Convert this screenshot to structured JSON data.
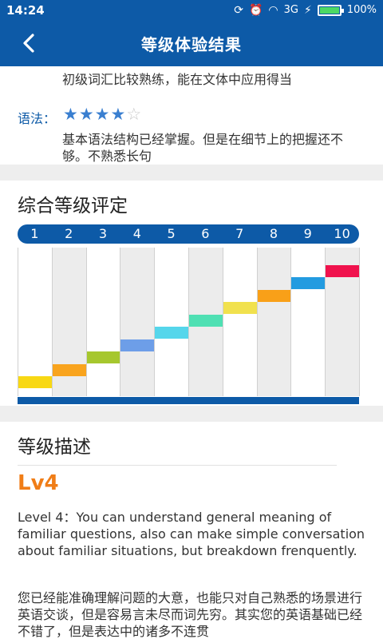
{
  "status_bar": {
    "time": "14:24",
    "network": "3G",
    "battery": "100%"
  },
  "nav": {
    "title": "等级体验结果",
    "back_icon": "chevron-left-icon"
  },
  "vocabulary": {
    "description": "初级词汇比较熟练，能在文体中应用得当"
  },
  "grammar": {
    "label": "语法：",
    "stars": 4,
    "max_stars": 5,
    "description": "基本语法结构已经掌握。但是在细节上的把握还不够。不熟悉长句"
  },
  "level_chart": {
    "title": "综合等级评定",
    "levels": [
      "1",
      "2",
      "3",
      "4",
      "5",
      "6",
      "7",
      "8",
      "9",
      "10"
    ],
    "colors": [
      "#f8d814",
      "#f9a41e",
      "#a6c72e",
      "#6d9ee8",
      "#55d6eb",
      "#4fe0b3",
      "#f1e14e",
      "#f9a018",
      "#239be0",
      "#f0124d"
    ]
  },
  "level_desc": {
    "title": "等级描述",
    "level": "Lv4",
    "english": "Level 4：You can understand general meaning of familiar questions, also can make simple conversation about familiar situations, but breakdown frenquently.",
    "chinese": "您已经能准确理解问题的大意，也能只对自己熟悉的场景进行英语交谈，但是容易言未尽而词先穷。其实您的英语基础已经不错了，但是表达中的诸多不连贯"
  },
  "colors": {
    "brand_blue": "#0d5aa7",
    "level_orange": "#f07d17",
    "star_blue": "#3a7fd0"
  }
}
